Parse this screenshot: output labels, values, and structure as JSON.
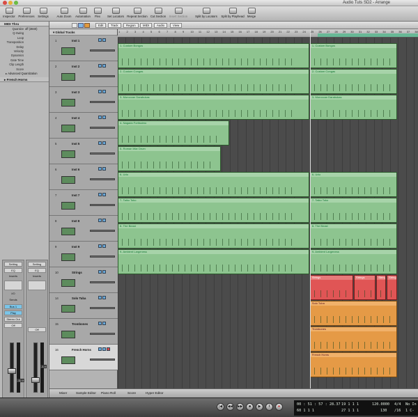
{
  "window": {
    "title": "Audio Tuts SD2 - Arrange"
  },
  "toolbar": {
    "buttons": [
      {
        "label": "Inspector"
      },
      {
        "label": "Preferences"
      },
      {
        "label": "Settings"
      },
      {
        "label": "Auto Zoom"
      },
      {
        "label": "Automation"
      },
      {
        "label": "Flex"
      },
      {
        "label": "Set Locators"
      },
      {
        "label": "Repeat Section"
      },
      {
        "label": "Cut Section"
      },
      {
        "label": "Insert Section"
      },
      {
        "label": "Split by Locators"
      },
      {
        "label": "Split by Playhead"
      },
      {
        "label": "Merge"
      }
    ]
  },
  "inspector": {
    "region_header": "MIDI Thru",
    "params": [
      {
        "label": "Quantize",
        "value": "off (3840)"
      },
      {
        "label": "Q-Swing",
        "value": ""
      },
      {
        "label": "Loop",
        "value": ""
      },
      {
        "label": "Transposition",
        "value": ""
      },
      {
        "label": "Delay",
        "value": ""
      },
      {
        "label": "Velocity",
        "value": ""
      },
      {
        "label": "Dynamics",
        "value": ""
      },
      {
        "label": "Gate Time",
        "value": ""
      },
      {
        "label": "Clip Length",
        "value": ""
      },
      {
        "label": "Score",
        "value": ""
      }
    ],
    "advanced": "Advanced Quantization",
    "track_header": "French Horns",
    "strip_left": {
      "setting": "Setting",
      "eq": "EQ",
      "inserts": "Inserts",
      "io": "I/O",
      "sends": "Sends",
      "bus": "Bus 1",
      "play": "Play",
      "output": "Stereo Out",
      "off": "Off",
      "value": "-12.0",
      "name": "French Ho"
    },
    "strip_right": {
      "setting": "Setting",
      "eq": "EQ",
      "inserts": "Inserts",
      "off": "Off",
      "value": "-1.0",
      "name": "Output"
    }
  },
  "arrange": {
    "menus": [
      "Edit",
      "Track",
      "Region",
      "MIDI",
      "Audio",
      "View"
    ],
    "global_tracks": "Global Tracks",
    "ruler": [
      "1",
      "2",
      "3",
      "4",
      "5",
      "6",
      "7",
      "8",
      "9",
      "10",
      "11",
      "12",
      "13",
      "14",
      "15",
      "16",
      "17",
      "18",
      "19",
      "20",
      "21",
      "22",
      "23",
      "24",
      "25",
      "26",
      "27",
      "28",
      "29",
      "30",
      "31",
      "32",
      "33",
      "34",
      "35",
      "36",
      "37",
      "38"
    ],
    "tracks": [
      {
        "num": "1",
        "name": "Inst 1"
      },
      {
        "num": "2",
        "name": "Inst 2"
      },
      {
        "num": "3",
        "name": "Inst 3"
      },
      {
        "num": "4",
        "name": "Inst 4"
      },
      {
        "num": "5",
        "name": "Inst 5"
      },
      {
        "num": "6",
        "name": "Inst 6"
      },
      {
        "num": "7",
        "name": "Inst 7"
      },
      {
        "num": "8",
        "name": "Inst 8"
      },
      {
        "num": "9",
        "name": "Inst 9"
      },
      {
        "num": "10",
        "name": "Strings"
      },
      {
        "num": "14",
        "name": "Solo Tuba"
      },
      {
        "num": "15",
        "name": "Trombones"
      },
      {
        "num": "16",
        "name": "French Horns"
      }
    ],
    "regions": [
      {
        "track": 0,
        "start": 1,
        "end": 25,
        "name": "1- Custom Bongos",
        "color": "green"
      },
      {
        "track": 0,
        "start": 25,
        "end": 36,
        "name": "1- Custom Bongos",
        "color": "green"
      },
      {
        "track": 1,
        "start": 1,
        "end": 25,
        "name": "2- Custom Congas",
        "color": "green"
      },
      {
        "track": 1,
        "start": 25,
        "end": 36,
        "name": "2- Custom Congas",
        "color": "green"
      },
      {
        "track": 2,
        "start": 1,
        "end": 25,
        "name": "3- Moroccan Darabukas",
        "color": "green"
      },
      {
        "track": 2,
        "start": 25,
        "end": 36,
        "name": "3- Moroccan Darabukas",
        "color": "green"
      },
      {
        "track": 3,
        "start": 1,
        "end": 15,
        "name": "4- Nagado Fortissimo",
        "color": "green"
      },
      {
        "track": 4,
        "start": 1,
        "end": 14,
        "name": "5- Roman War Drum",
        "color": "green"
      },
      {
        "track": 5,
        "start": 1,
        "end": 25,
        "name": "6- Udu",
        "color": "green"
      },
      {
        "track": 5,
        "start": 25,
        "end": 36,
        "name": "6- Udu",
        "color": "green"
      },
      {
        "track": 6,
        "start": 1,
        "end": 25,
        "name": "7- Taiko Toko",
        "color": "green"
      },
      {
        "track": 6,
        "start": 25,
        "end": 36,
        "name": "7- Taiko Toko",
        "color": "green"
      },
      {
        "track": 7,
        "start": 1,
        "end": 25,
        "name": "8- The Beast",
        "color": "green"
      },
      {
        "track": 7,
        "start": 25,
        "end": 36,
        "name": "8- The Beast",
        "color": "green"
      },
      {
        "track": 8,
        "start": 1,
        "end": 25,
        "name": "9- Ambient Largeness",
        "color": "green"
      },
      {
        "track": 8,
        "start": 25,
        "end": 36,
        "name": "9- Ambient Largeness",
        "color": "green"
      },
      {
        "track": 9,
        "start": 25,
        "end": 30.5,
        "name": "Strings",
        "color": "red"
      },
      {
        "track": 9,
        "start": 30.5,
        "end": 33.3,
        "name": "Strings",
        "color": "red"
      },
      {
        "track": 9,
        "start": 33.3,
        "end": 34.6,
        "name": "Strings",
        "color": "red"
      },
      {
        "track": 9,
        "start": 34.6,
        "end": 36,
        "name": "Strings",
        "color": "red"
      },
      {
        "track": 10,
        "start": 25,
        "end": 36,
        "name": "Solo Tuba",
        "color": "orange"
      },
      {
        "track": 11,
        "start": 25,
        "end": 36,
        "name": "Trombones",
        "color": "orange"
      },
      {
        "track": 12,
        "start": 25,
        "end": 36,
        "name": "French Horns",
        "color": "orange"
      }
    ]
  },
  "bottom_tabs": [
    "Mixer",
    "Sample Editor",
    "Piano Roll",
    "Score",
    "Hyper Editor"
  ],
  "transport": {
    "buttons": [
      "|◀",
      "◀◀",
      "▶▶",
      "■",
      "▶",
      "‖",
      "●"
    ],
    "time_smpte": "00 : 51 : 57 : 28.37",
    "time_smpte2": "60    1    1    1",
    "bars": "19    1    1    1",
    "bars2": "27    1    1    1",
    "tempo": "120.0000",
    "tempo2": "130",
    "signature": "4/4",
    "division": "/16",
    "extra1": "No In",
    "extra2": "1 C-"
  },
  "colors": {
    "region_green": "#8dc48f",
    "region_red": "#e05555",
    "region_orange": "#e59a46",
    "cycle": "#68b896"
  }
}
